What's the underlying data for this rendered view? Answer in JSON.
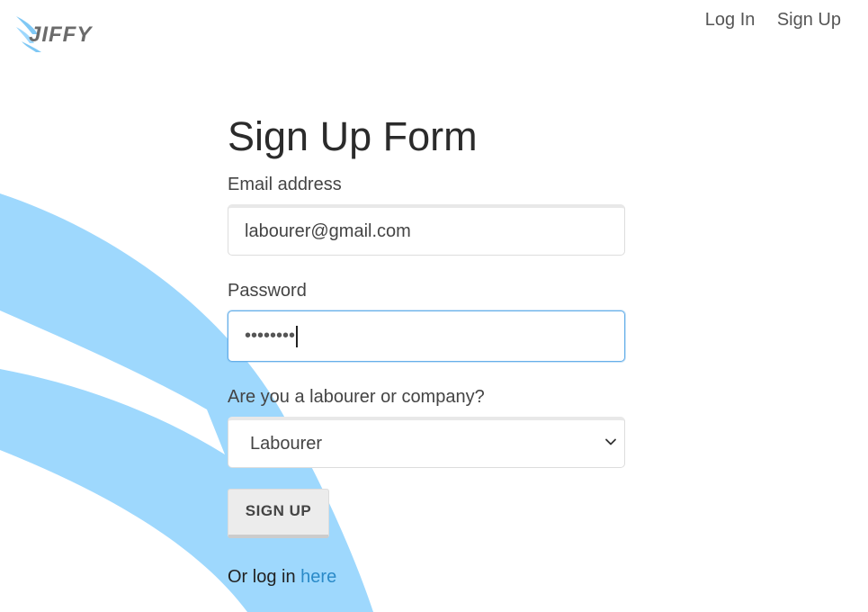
{
  "app": {
    "logo_text": "JIFFY"
  },
  "nav": {
    "login_label": "Log In",
    "signup_label": "Sign Up"
  },
  "form": {
    "title": "Sign Up Form",
    "email": {
      "label": "Email address",
      "value": "labourer@gmail.com"
    },
    "password": {
      "label": "Password",
      "masked_value": "••••••••"
    },
    "role": {
      "label": "Are you a labourer or company?",
      "selected": "Labourer"
    },
    "submit_label": "SIGN UP",
    "footer_prefix": "Or log in",
    "footer_link": "here"
  },
  "colors": {
    "accent_blue": "#9ed8fd",
    "link_blue": "#2a8ac8",
    "focus_blue": "#66afe9"
  },
  "icons": {
    "logo_mark": "wing-icon",
    "select_arrow": "chevron-down-icon"
  }
}
